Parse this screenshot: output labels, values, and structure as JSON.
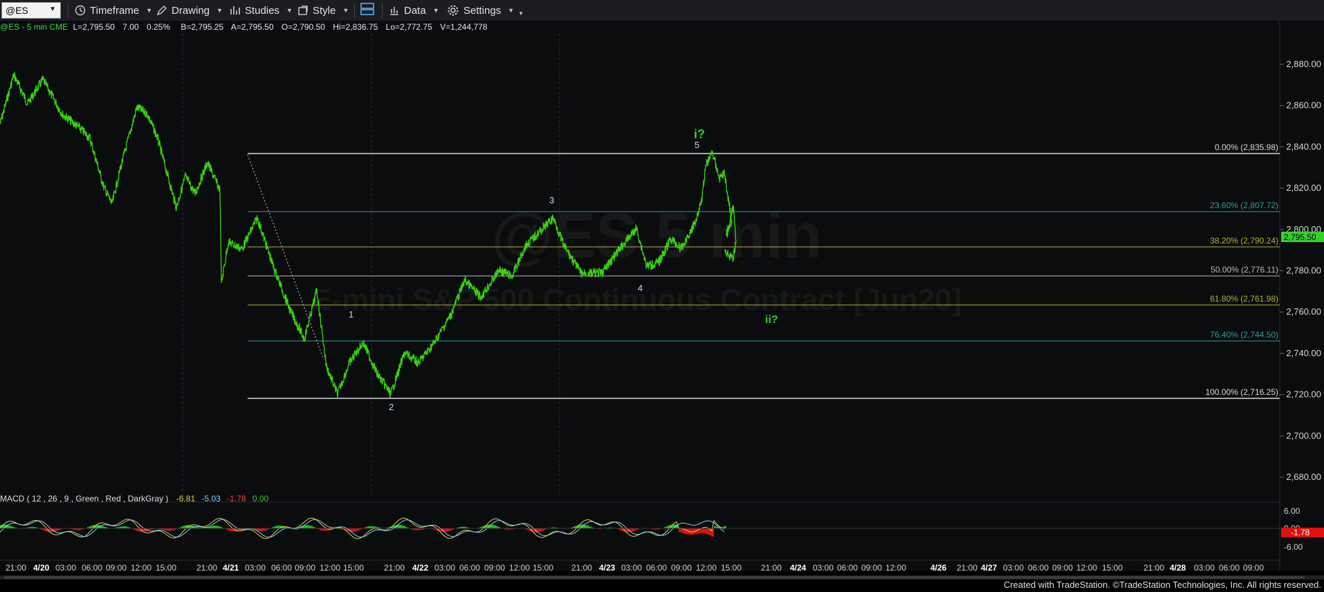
{
  "toolbar": {
    "symbol": "@ES",
    "timeframe": "Timeframe",
    "drawing": "Drawing",
    "studies": "Studies",
    "style": "Style",
    "data": "Data",
    "settings": "Settings"
  },
  "info_bar": {
    "symbol": "@ES - 5 min  CME",
    "last": "L=2,795.50",
    "change": "7.00",
    "pct": "0.25%",
    "bid": "B=2,795.25",
    "ask": "A=2,795.50",
    "open": "O=2,790.50",
    "high": "Hi=2,836.75",
    "low": "Lo=2,772.75",
    "volume": "V=1,244,778"
  },
  "watermark": {
    "line1": "@ES 5 min",
    "line2": "E-mini S&P 500 Continuous Contract [Jun20]"
  },
  "price_axis": [
    "2,880.00",
    "2,860.00",
    "2,840.00",
    "2,820.00",
    "2,800.00",
    "2,780.00",
    "2,760.00",
    "2,740.00",
    "2,720.00",
    "2,700.00",
    "2,680.00"
  ],
  "current_price": "2,795.50",
  "fib_levels": [
    {
      "label": "0.00% (2,835.98)",
      "color": "#d8d8d8"
    },
    {
      "label": "23.60% (2,807.72)",
      "color": "#2f9e96"
    },
    {
      "label": "38.20% (2,790.24)",
      "color": "#b5b13a"
    },
    {
      "label": "50.00% (2,776.11)",
      "color": "#bdbdbd"
    },
    {
      "label": "61.80% (2,761.98)",
      "color": "#b5b13a"
    },
    {
      "label": "76.40% (2,744.50)",
      "color": "#2f9e96"
    },
    {
      "label": "100.00% (2,716.25)",
      "color": "#d8d8d8"
    }
  ],
  "wave_labels": [
    "1",
    "2",
    "3",
    "4",
    "5"
  ],
  "annotations": {
    "wave_i": "i?",
    "wave_ii": "ii?"
  },
  "macd": {
    "title": "MACD ( 12 , 26 , 9 , Green , Red , DarkGray )",
    "v1": "-6.81",
    "v2": "-5.03",
    "v3": "-1.78",
    "v4": "0.00",
    "axis": [
      "6.00",
      "0.00",
      "-6.00"
    ],
    "current": "-1.78"
  },
  "time_axis": [
    "21:00",
    "4/20",
    "03:00",
    "06:00",
    "09:00",
    "12:00",
    "15:00",
    "21:00",
    "4/21",
    "03:00",
    "06:00",
    "09:00",
    "12:00",
    "15:00",
    "21:00",
    "4/22",
    "03:00",
    "06:00",
    "09:00",
    "12:00",
    "15:00",
    "21:00",
    "4/23",
    "03:00",
    "06:00",
    "09:00",
    "12:00",
    "15:00",
    "21:00",
    "4/24",
    "03:00",
    "06:00",
    "09:00",
    "12:00",
    "4/26",
    "21:00",
    "4/27",
    "03:00",
    "06:00",
    "09:00",
    "12:00",
    "15:00",
    "21:00",
    "4/28",
    "03:00",
    "06:00",
    "09:00"
  ],
  "footer": "Created with TradeStation. ©TradeStation Technologies, Inc. All rights reserved.",
  "colors": {
    "price": "#39d30f",
    "up": "#1fbf1f",
    "down": "#e01010",
    "accent": "#4aa3df"
  }
}
